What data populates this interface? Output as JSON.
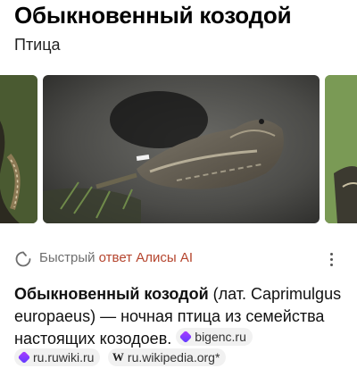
{
  "header": {
    "title": "Обыкновенный козодой",
    "subtitle": "Птица"
  },
  "gallery": {
    "images": [
      {
        "name": "thumb-left"
      },
      {
        "name": "nightjar-photo"
      },
      {
        "name": "thumb-right"
      }
    ]
  },
  "alice": {
    "label_plain": "Быстрый ",
    "label_accent": "ответ Алисы AI",
    "icon": "alice-ring-icon",
    "more_icon": "more-vertical-icon"
  },
  "answer": {
    "term": "Обыкновенный козодой",
    "text": " (лат. Caprimulgus europaeus) — ночная птица из семейства настоящих козодоев.",
    "sources": [
      {
        "label": "bigenc.ru",
        "icon": "bigenc-icon"
      },
      {
        "label": "ru.ruwiki.ru",
        "icon": "ruwiki-icon"
      },
      {
        "label": "ru.wikipedia.org*",
        "icon": "wikipedia-icon",
        "icon_glyph": "W"
      }
    ]
  },
  "colors": {
    "accent": "#b5452e",
    "muted": "#6e6e6e",
    "chip_bg": "#f1f1f1"
  }
}
